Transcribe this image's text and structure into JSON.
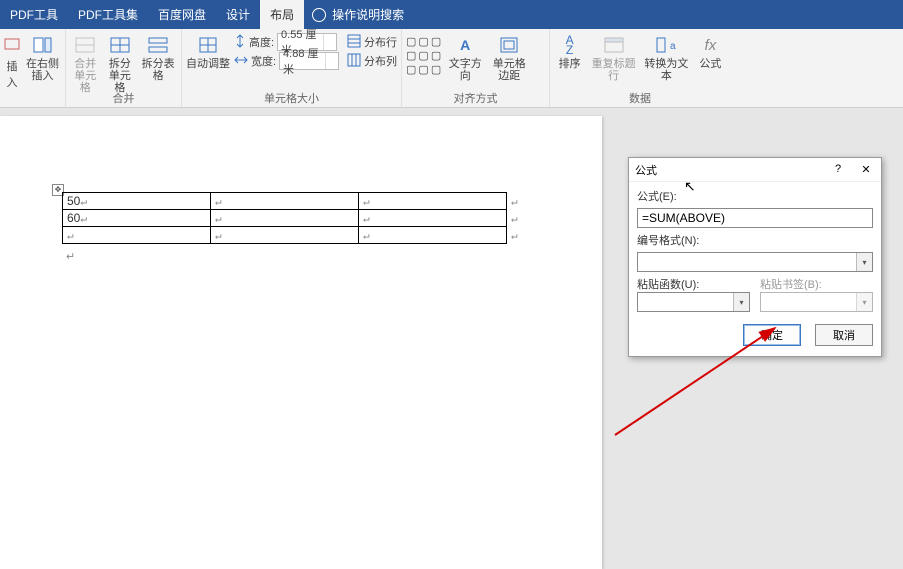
{
  "tabs": {
    "pdf_tool": "PDF工具",
    "pdf_suite": "PDF工具集",
    "baidu": "百度网盘",
    "design": "设计",
    "layout": "布局",
    "search_hint": "操作说明搜索"
  },
  "ribbon": {
    "insert_right": "在右侧插入",
    "insert_short": "插入",
    "merge_cell": "合并\n单元格",
    "split_cell": "拆分\n单元格",
    "split_table": "拆分表格",
    "merge_group": "合并",
    "autofit": "自动调整",
    "height_lbl": "高度:",
    "height_val": "0.55 厘米",
    "width_lbl": "宽度:",
    "width_val": "4.88 厘米",
    "dist_rows": "分布行",
    "dist_cols": "分布列",
    "cellsize_group": "单元格大小",
    "text_dir": "文字方向",
    "cell_margin": "单元格\n边距",
    "align_group": "对齐方式",
    "sort": "排序",
    "repeat_header": "重复标题行",
    "to_text": "转换为文本",
    "formula": "公式",
    "data_group": "数据"
  },
  "table": {
    "r1c1": "50",
    "r2c1": "60"
  },
  "dialog": {
    "title": "公式",
    "help": "?",
    "formula_lbl": "公式(E):",
    "formula_val": "=SUM(ABOVE)",
    "number_fmt_lbl": "编号格式(N):",
    "paste_fn_lbl": "粘贴函数(U):",
    "paste_bm_lbl": "粘贴书签(B):",
    "ok": "确定",
    "cancel": "取消"
  }
}
